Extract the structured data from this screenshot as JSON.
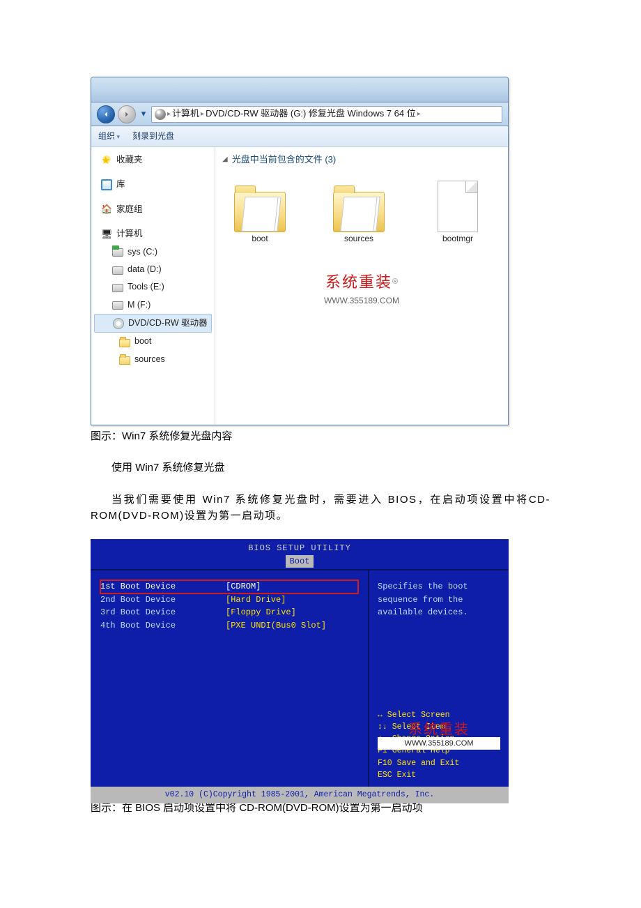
{
  "explorer": {
    "breadcrumb": {
      "seg1": "计算机",
      "seg2": "DVD/CD-RW 驱动器 (G:) 修复光盘 Windows 7 64 位"
    },
    "toolbar": {
      "organize": "组织",
      "burn": "刻录到光盘"
    },
    "sidebar": {
      "favorites": "收藏夹",
      "libraries": "库",
      "homegroup": "家庭组",
      "computer": "计算机",
      "drives": {
        "c": "sys (C:)",
        "d": "data (D:)",
        "e": "Tools (E:)",
        "f": "M (F:)",
        "cd": "DVD/CD-RW 驱动器",
        "boot": "boot",
        "sources": "sources"
      }
    },
    "content": {
      "header": "光盘中当前包含的文件 (3)",
      "files": {
        "boot": "boot",
        "sources": "sources",
        "bootmgr": "bootmgr"
      }
    },
    "watermark": {
      "brand": "系统重装",
      "reg": "®",
      "url": "WWW.355189.COM"
    }
  },
  "captions": {
    "c1": "图示：Win7 系统修复光盘内容",
    "c2": "图示：在 BIOS 启动项设置中将 CD-ROM(DVD-ROM)设置为第一启动项"
  },
  "article": {
    "p1": "使用 Win7 系统修复光盘",
    "p2": "当我们需要使用 Win7 系统修复光盘时，需要进入 BIOS，在启动项设置中将CD-ROM(DVD-ROM)设置为第一启动项。"
  },
  "bios": {
    "title": "BIOS SETUP UTILITY",
    "tab": "Boot",
    "items": [
      {
        "k": "1st Boot Device",
        "v": "[CDROM]"
      },
      {
        "k": "2nd Boot Device",
        "v": "[Hard Drive]"
      },
      {
        "k": "3rd Boot Device",
        "v": "[Floppy Drive]"
      },
      {
        "k": "4th Boot Device",
        "v": "[PXE UNDI(Bus0 Slot]"
      }
    ],
    "help": "Specifies the boot sequence from the available devices.",
    "keys": {
      "l1": "↔     Select Screen",
      "l2": "↕↓    Select Item",
      "l3": "+-    Change Option",
      "l4": "F1    General Help",
      "l5": "F10   Save and Exit",
      "l6": "ESC   Exit"
    },
    "watermark": {
      "brand": "系统重装",
      "url": "WWW.355189.COM"
    },
    "footer": "v02.10 (C)Copyright 1985-2001, American Megatrends, Inc."
  }
}
